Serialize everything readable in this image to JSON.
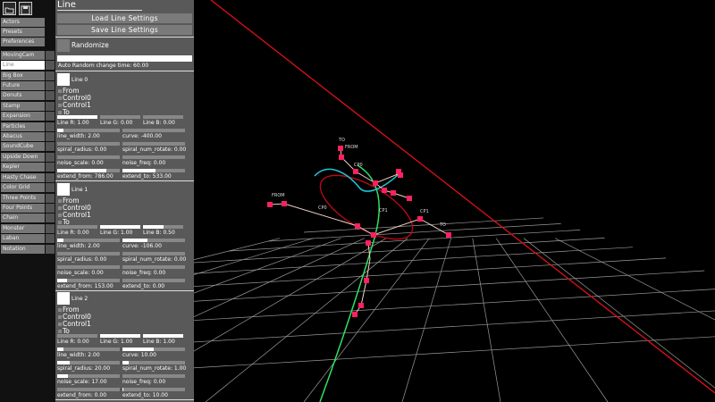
{
  "toolbar": {
    "open_icon": "folder-icon",
    "save_icon": "floppy-icon"
  },
  "sidebar": {
    "active": "Line",
    "items": [
      "Actors",
      "Presets",
      "Preferences",
      "MovingCam",
      "Line",
      "Big Box",
      "Future",
      "Donuts",
      "Stamp",
      "Expansion",
      "Particles",
      "Abacus",
      "SoundCube",
      "Upside Down",
      "Kepler",
      "Hasty Chase",
      "Color Grid",
      "Three Points",
      "Four Points",
      "Chain",
      "Monster",
      "Laban",
      "Notation"
    ]
  },
  "panel": {
    "title": "Line",
    "load_label": "Load Line Settings",
    "save_label": "Save Line Settings",
    "randomize_label": "Randomize",
    "auto_random_label": "Auto Random change time: 60.00",
    "auto_random_value": 0.5,
    "lines": [
      {
        "title": "Line 0",
        "radios": [
          "From",
          "Control0",
          "Control1",
          "To"
        ],
        "r": "Line R: 1.00",
        "g": "Line G: 0.00",
        "b": "Line B: 0.00",
        "r_val": 1.0,
        "g_val": 0.0,
        "b_val": 0.0,
        "line_width": "line_width: 2.00",
        "curve": "curve: -400.00",
        "line_width_val": 0.1,
        "curve_val": 0.0,
        "spiral_radius": "spiral_radius: 0.00",
        "spiral_num_rotate": "spiral_num_rotate: 0.00",
        "spiral_radius_val": 0.0,
        "spiral_num_rotate_val": 0.0,
        "noise_scale": "noise_scale: 0.00",
        "noise_freq": "noise_freq: 0.00",
        "noise_scale_val": 0.0,
        "noise_freq_val": 0.0,
        "extend_from": "extend_from: 786.00",
        "extend_to": "extend_to: 533.00",
        "extend_from_val": 0.78,
        "extend_to_val": 0.53
      },
      {
        "title": "Line 1",
        "radios": [
          "From",
          "Control0",
          "Control1",
          "To"
        ],
        "r": "Line R: 0.00",
        "g": "Line G: 1.00",
        "b": "Line B: 0.50",
        "r_val": 0.0,
        "g_val": 1.0,
        "b_val": 0.5,
        "line_width": "line_width: 2.00",
        "curve": "curve: -106.00",
        "line_width_val": 0.1,
        "curve_val": 0.4,
        "spiral_radius": "spiral_radius: 0.00",
        "spiral_num_rotate": "spiral_num_rotate: 0.00",
        "spiral_radius_val": 0.0,
        "spiral_num_rotate_val": 0.0,
        "noise_scale": "noise_scale: 0.00",
        "noise_freq": "noise_freq: 0.00",
        "noise_scale_val": 0.0,
        "noise_freq_val": 0.0,
        "extend_from": "extend_from: 153.00",
        "extend_to": "extend_to: 0.00",
        "extend_from_val": 0.15,
        "extend_to_val": 0.0
      },
      {
        "title": "Line 2",
        "radios": [
          "From",
          "Control0",
          "Control1",
          "To"
        ],
        "r": "Line R: 0.00",
        "g": "Line G: 1.00",
        "b": "Line B: 1.00",
        "r_val": 0.0,
        "g_val": 1.0,
        "b_val": 1.0,
        "line_width": "line_width: 2.00",
        "curve": "curve: 10.00",
        "line_width_val": 0.1,
        "curve_val": 0.5,
        "spiral_radius": "spiral_radius: 20.00",
        "spiral_num_rotate": "spiral_num_rotate: 1.00",
        "spiral_radius_val": 0.2,
        "spiral_num_rotate_val": 0.1,
        "noise_scale": "noise_scale: 17.00",
        "noise_freq": "noise_freq: 0.00",
        "noise_scale_val": 0.17,
        "noise_freq_val": 0.0,
        "extend_from": "extend_from: 0.00",
        "extend_to": "extend_to: 10.00",
        "extend_from_val": 0.0,
        "extend_to_val": 0.01
      }
    ]
  },
  "scene": {
    "labels": [
      "TO",
      "FROM",
      "CP0",
      "FROM",
      "CP0",
      "CP1",
      "CP1",
      "TO"
    ],
    "colors": {
      "red_line": "#e0101a",
      "cyan_curve": "#20c8d8",
      "green_curve": "#30e060",
      "node": "#ff2060",
      "grid": "#9a9a9a"
    }
  }
}
